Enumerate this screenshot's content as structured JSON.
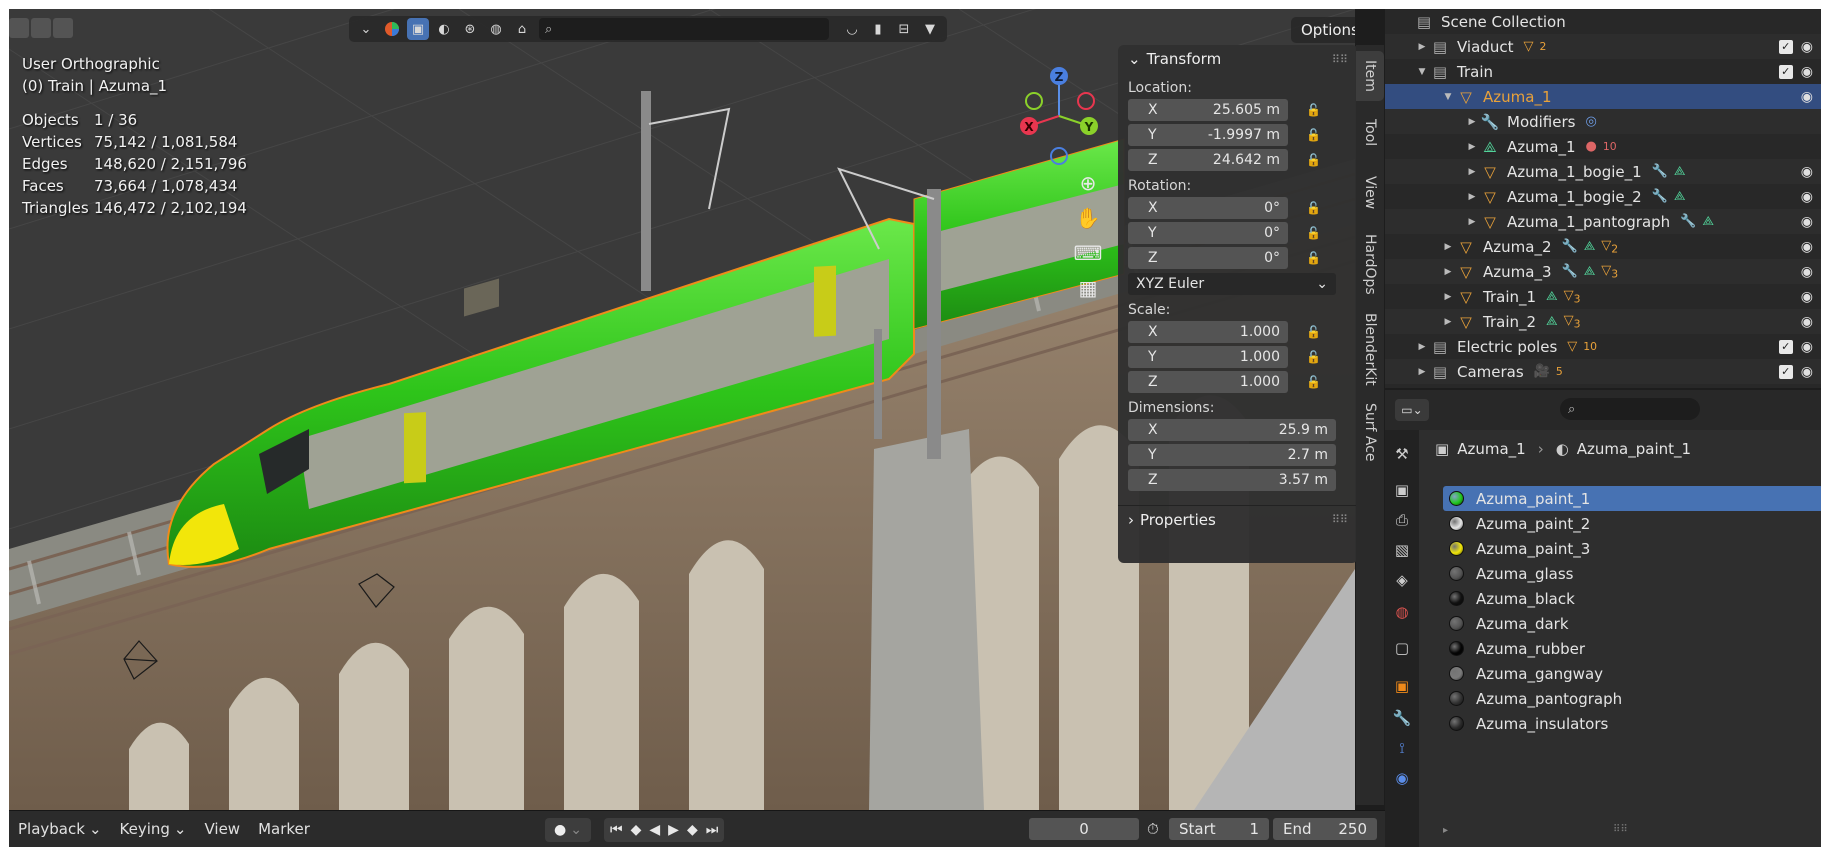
{
  "viewport": {
    "view_name": "User Orthographic",
    "context": "(0) Train | Azuma_1",
    "stats": [
      {
        "label": "Objects",
        "value": "1 / 36"
      },
      {
        "label": "Vertices",
        "value": "75,142 / 1,081,584"
      },
      {
        "label": "Edges",
        "value": "148,620 / 2,151,796"
      },
      {
        "label": "Faces",
        "value": "73,664 / 1,078,434"
      },
      {
        "label": "Triangles",
        "value": "146,472 / 2,102,194"
      }
    ],
    "options_label": "Options",
    "gizmo": {
      "z": "Z",
      "x": "X",
      "y": "Y"
    }
  },
  "npanel": {
    "section_transform": "Transform",
    "location_label": "Location:",
    "location": [
      {
        "axis": "X",
        "value": "25.605 m"
      },
      {
        "axis": "Y",
        "value": "-1.9997 m"
      },
      {
        "axis": "Z",
        "value": "24.642 m"
      }
    ],
    "rotation_label": "Rotation:",
    "rotation": [
      {
        "axis": "X",
        "value": "0°"
      },
      {
        "axis": "Y",
        "value": "0°"
      },
      {
        "axis": "Z",
        "value": "0°"
      }
    ],
    "rotation_mode": "XYZ Euler",
    "scale_label": "Scale:",
    "scale": [
      {
        "axis": "X",
        "value": "1.000"
      },
      {
        "axis": "Y",
        "value": "1.000"
      },
      {
        "axis": "Z",
        "value": "1.000"
      }
    ],
    "dimensions_label": "Dimensions:",
    "dimensions": [
      {
        "axis": "X",
        "value": "25.9 m"
      },
      {
        "axis": "Y",
        "value": "2.7 m"
      },
      {
        "axis": "Z",
        "value": "3.57 m"
      }
    ],
    "section_properties": "Properties"
  },
  "side_tabs": [
    "Item",
    "Tool",
    "View",
    "HardOps",
    "BlenderKit",
    "Surf Ace"
  ],
  "timeline": {
    "menus": [
      "Playback",
      "Keying",
      "View",
      "Marker"
    ],
    "current_frame": "0",
    "start_label": "Start",
    "start_value": "1",
    "end_label": "End",
    "end_value": "250"
  },
  "outliner": {
    "root": "Scene Collection",
    "rows": [
      {
        "name": "Viaduct",
        "kind": "collection",
        "extra": "2"
      },
      {
        "name": "Train",
        "kind": "collection",
        "extra": ""
      },
      {
        "name": "Azuma_1",
        "kind": "object",
        "extra": ""
      },
      {
        "name": "Modifiers",
        "kind": "modifiers",
        "extra": ""
      },
      {
        "name": "Azuma_1",
        "kind": "mesh",
        "extra": "10"
      },
      {
        "name": "Azuma_1_bogie_1",
        "kind": "object",
        "extra": ""
      },
      {
        "name": "Azuma_1_bogie_2",
        "kind": "object",
        "extra": ""
      },
      {
        "name": "Azuma_1_pantograph",
        "kind": "object",
        "extra": ""
      },
      {
        "name": "Azuma_2",
        "kind": "object",
        "extra": "2"
      },
      {
        "name": "Azuma_3",
        "kind": "object",
        "extra": "3"
      },
      {
        "name": "Train_1",
        "kind": "object",
        "extra": "3"
      },
      {
        "name": "Train_2",
        "kind": "object",
        "extra": "3"
      },
      {
        "name": "Electric poles",
        "kind": "collection",
        "extra": "10"
      },
      {
        "name": "Cameras",
        "kind": "collection",
        "extra": "5"
      }
    ]
  },
  "properties": {
    "breadcrumb_object": "Azuma_1",
    "breadcrumb_material": "Azuma_paint_1",
    "materials": [
      {
        "name": "Azuma_paint_1",
        "color": "#22c81e"
      },
      {
        "name": "Azuma_paint_2",
        "color": "#e6e6e6"
      },
      {
        "name": "Azuma_paint_3",
        "color": "#f0e60a"
      },
      {
        "name": "Azuma_glass",
        "color": "#555555"
      },
      {
        "name": "Azuma_black",
        "color": "#111111"
      },
      {
        "name": "Azuma_dark",
        "color": "#555555"
      },
      {
        "name": "Azuma_rubber",
        "color": "#050505"
      },
      {
        "name": "Azuma_gangway",
        "color": "#7a7a7a"
      },
      {
        "name": "Azuma_pantograph",
        "color": "#333333"
      },
      {
        "name": "Azuma_insulators",
        "color": "#2a2a2a"
      }
    ]
  },
  "colors": {
    "accent": "#4772b3",
    "selection_outline": "#f08a1a",
    "train_green": "#2ecc1a"
  }
}
